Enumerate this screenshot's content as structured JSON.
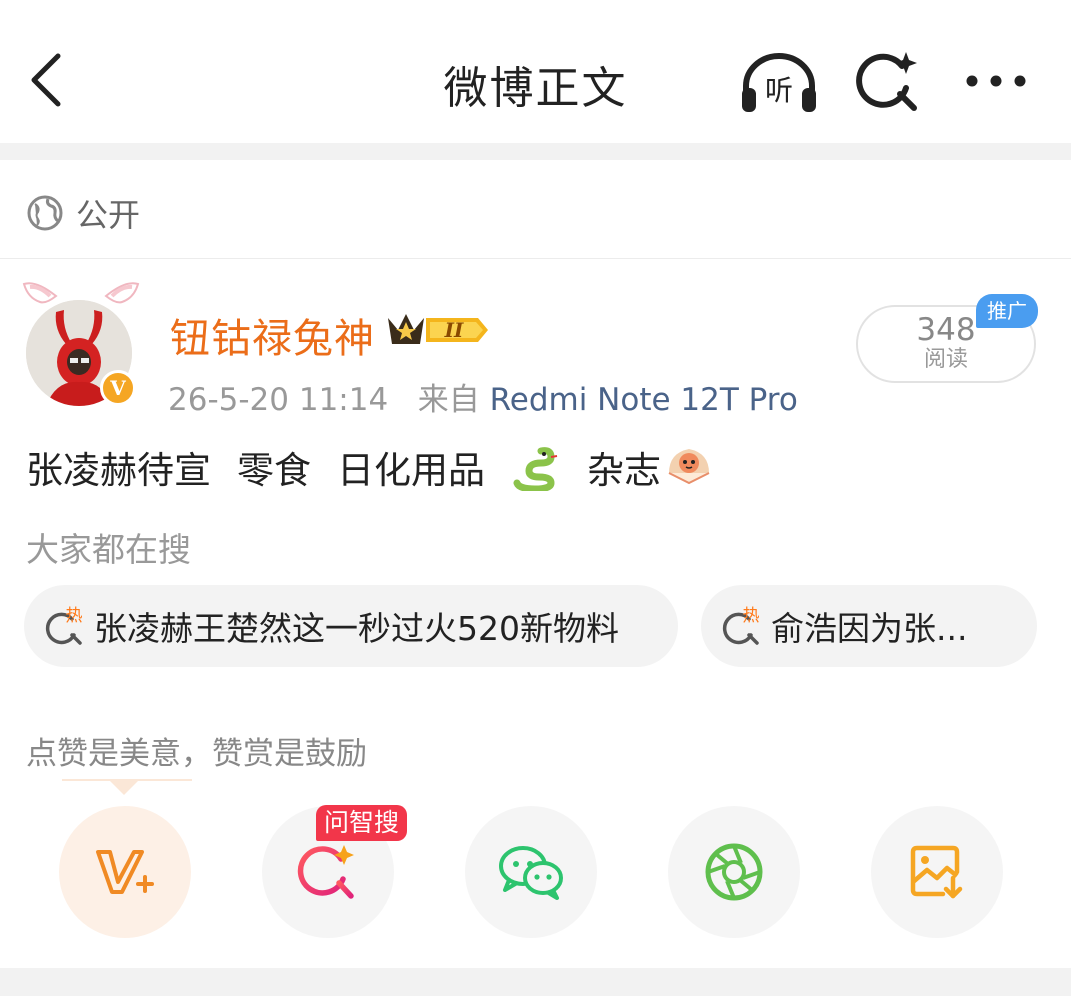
{
  "nav": {
    "title": "微博正文",
    "listen_label": "听"
  },
  "privacy": {
    "label": "公开"
  },
  "post": {
    "username": "钮钴禄兔神",
    "member_level": "II",
    "time": "26-5-20 11:14",
    "source_prefix": "来自",
    "source": "Redmi Note 12T Pro",
    "reads": {
      "count": "348",
      "label": "阅读"
    },
    "promo_badge": "推广",
    "content_segments": [
      "张凌赫待宣",
      "零食",
      "日化用品",
      "杂志"
    ],
    "content_emojis": [
      "snake-emoji",
      "fan-character-emoji"
    ]
  },
  "trending": {
    "title": "大家都在搜",
    "hot_tag": "热",
    "items": [
      "张凌赫王楚然这一秒过火520新物料",
      "俞浩因为张..."
    ]
  },
  "reward": {
    "title": "点赞是美意，赞赏是鼓励",
    "ai_badge": "问智搜",
    "actions": [
      "reward-v-plus",
      "ai-search",
      "wechat",
      "moments",
      "save-image"
    ]
  },
  "colors": {
    "username": "#eb6d19",
    "source_link": "#4a6389",
    "promo": "#4a9df0",
    "ai_badge": "#f2364a",
    "wechat": "#2dc46e",
    "moments": "#5fbf4d",
    "save": "#f5a623"
  }
}
